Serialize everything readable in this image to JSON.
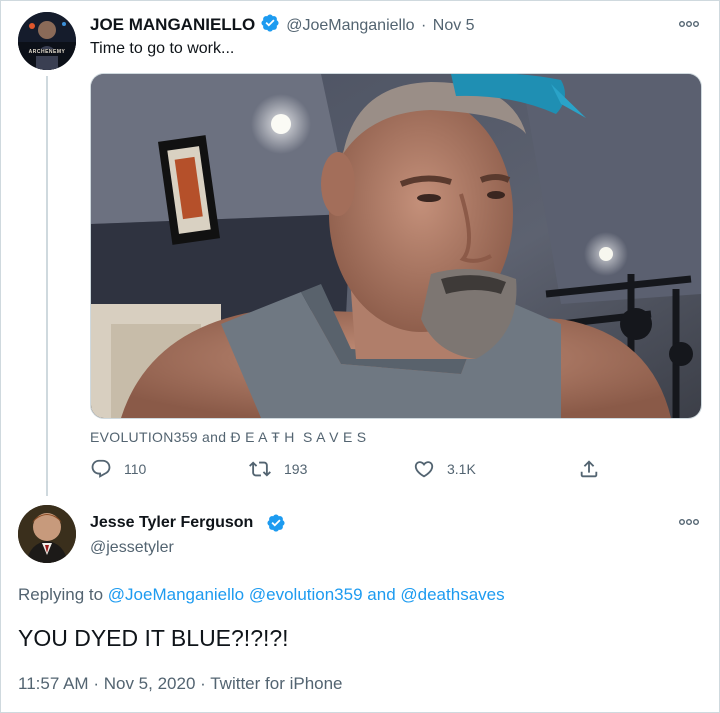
{
  "tweet": {
    "author_name": "JOE MANGANIELLO",
    "handle": "@JoeManganiello",
    "separator": "·",
    "date": "Nov 5",
    "text": "Time to go to work...",
    "media_tags": "EVOLUTION359 and Ɖ Ε Α Ŧ Η  S A V E S",
    "avatar_caption": "ARCHENEMY",
    "actions": {
      "replies": "110",
      "retweets": "193",
      "likes": "3.1K"
    }
  },
  "reply": {
    "author_name": "Jesse Tyler Ferguson",
    "handle": "@jessetyler",
    "replying_prefix": "Replying to",
    "mention_1": "@JoeManganiello",
    "mention_2": "@evolution359",
    "and_word": "and",
    "mention_3": "@deathsaves",
    "text": "YOU DYED IT BLUE?!?!?!",
    "time": "11:57 AM",
    "sep1": "·",
    "date": "Nov 5, 2020",
    "sep2": "·",
    "source": "Twitter for iPhone"
  },
  "colors": {
    "accent": "#1d9bf0",
    "muted": "#536471",
    "hair_blue": "#1f8fb3"
  },
  "icons": [
    "verified-badge-icon",
    "more-options-icon",
    "reply-icon",
    "retweet-icon",
    "like-icon",
    "share-icon"
  ]
}
